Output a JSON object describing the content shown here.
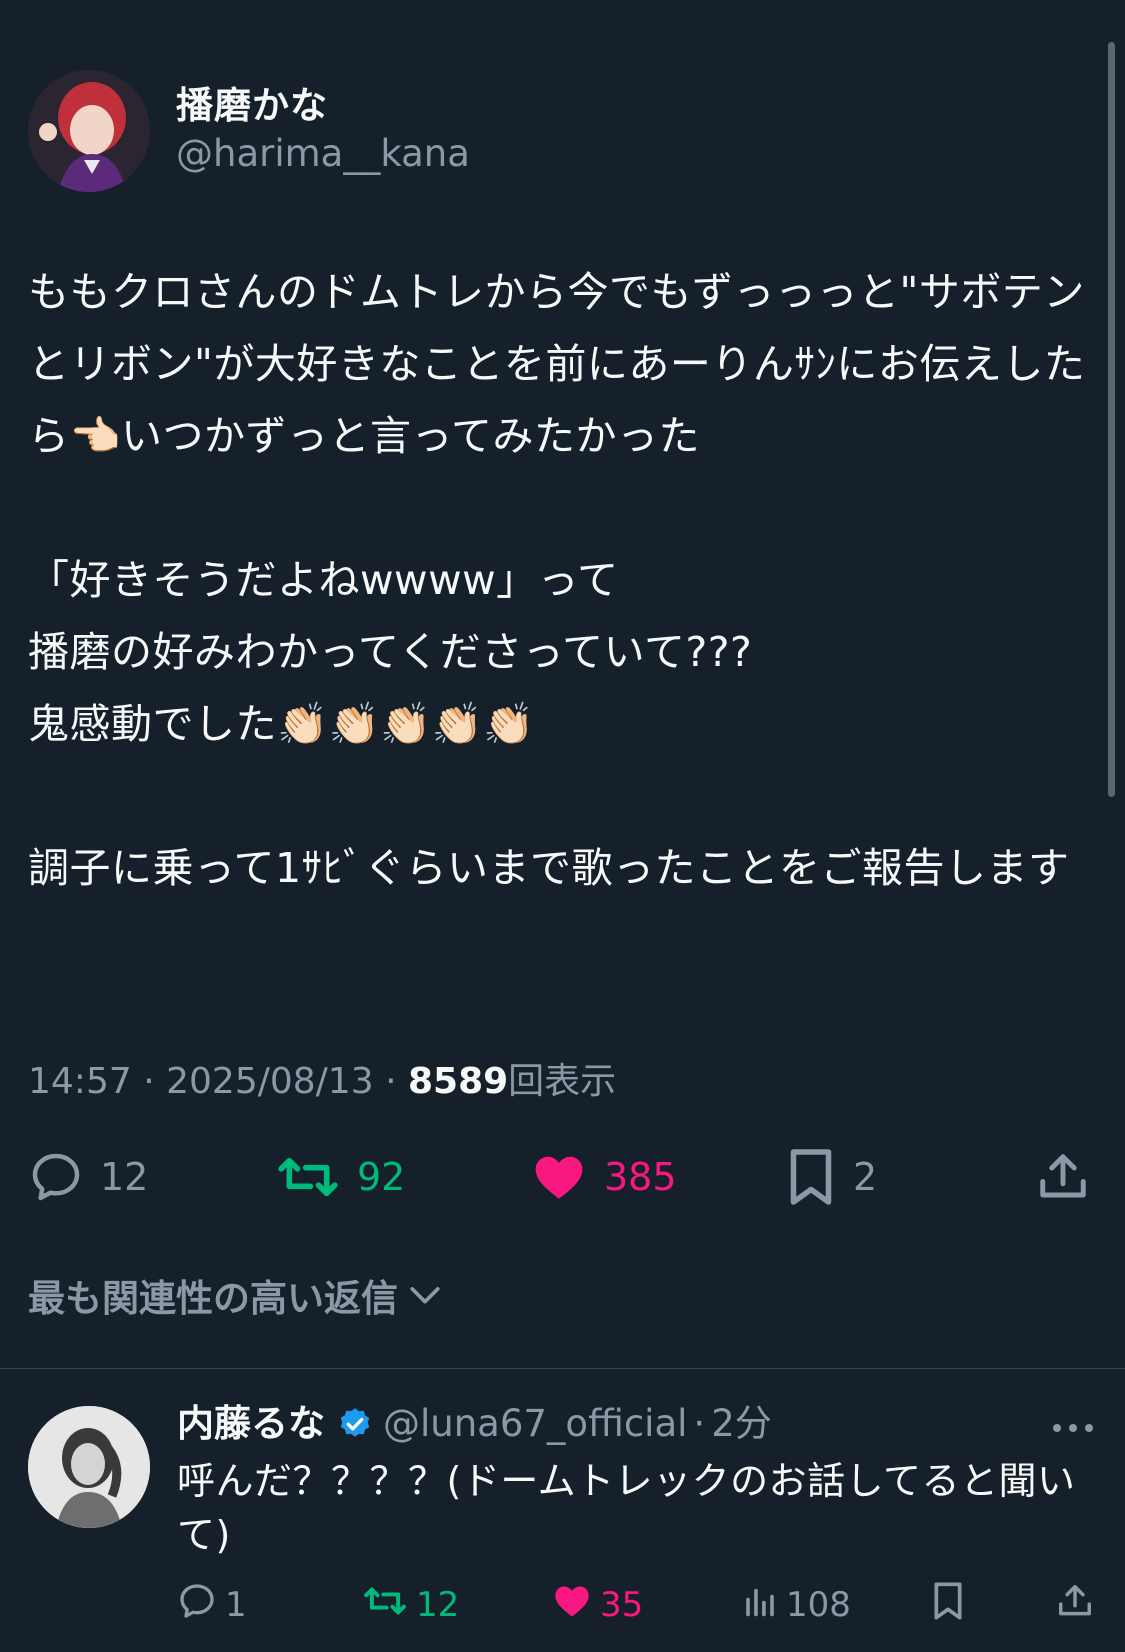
{
  "tweet": {
    "display_name": "播磨かな",
    "handle": "@harima__kana",
    "text": "ももクロさんのドムトレから今でもずっっっと\"サボテンとリボン\"が大好きなことを前にあーりんｻﾝにお伝えしたら👈🏻いつかずっと言ってみたかった\n\n「好きそうだよねwwww」って\n播磨の好みわかってくださっていて???\n鬼感動でした👏🏻👏🏻👏🏻👏🏻👏🏻\n\n調子に乗って1ｻﾋﾞぐらいまで歌ったことをご報告します",
    "time": "14:57",
    "date": "2025/08/13",
    "views": "8589",
    "views_label": "回表示",
    "separator": "·",
    "replies": "12",
    "retweets": "92",
    "likes": "385",
    "bookmarks": "2"
  },
  "sort_label": "最も関連性の高い返信",
  "reply": {
    "display_name": "内藤るな",
    "handle": "@luna67_official",
    "time": "2分",
    "separator": "·",
    "text": "呼んだ？？？？(ドームトレックのお話してると聞いて)",
    "replies": "1",
    "retweets": "12",
    "likes": "35",
    "views": "108"
  },
  "colors": {
    "background": "#15202b",
    "retweet_green": "#00ba7c",
    "like_pink": "#f91880",
    "verified_blue": "#1d9bf0",
    "muted": "#8b98a5"
  },
  "icons": [
    "reply-icon",
    "retweet-icon",
    "like-icon",
    "bookmark-icon",
    "share-icon",
    "chevron-down-icon",
    "verified-icon",
    "more-icon",
    "views-icon"
  ]
}
